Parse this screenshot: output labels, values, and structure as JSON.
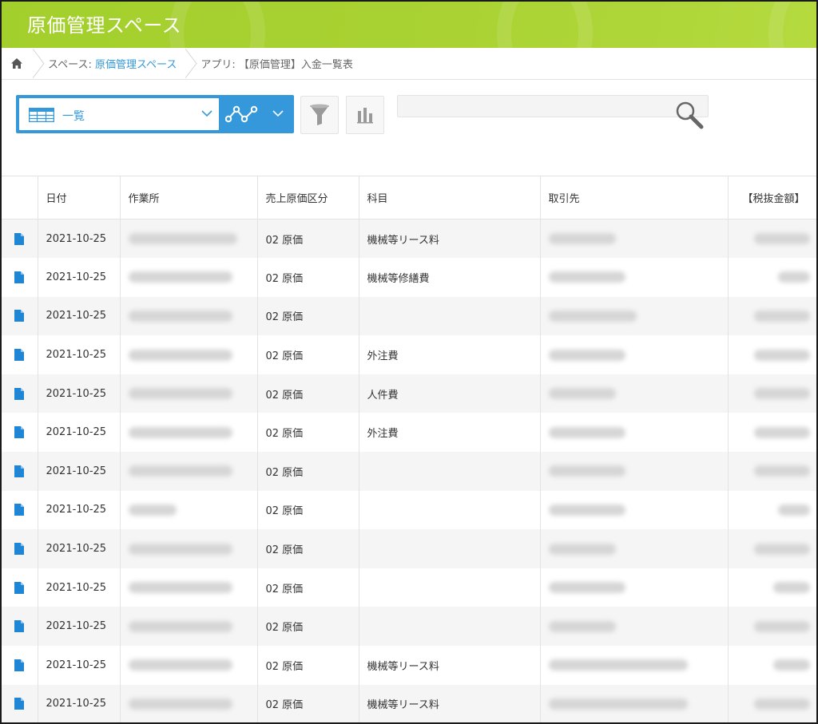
{
  "header": {
    "title": "原価管理スペース",
    "color": "#a9d232"
  },
  "breadcrumb": {
    "space_prefix": "スペース: ",
    "space_name": "原価管理スペース",
    "app_label": "アプリ: 【原価管理】入金一覧表"
  },
  "toolbar": {
    "view_label": "一覧",
    "search_placeholder": "",
    "accent_color": "#3498db"
  },
  "table": {
    "headers": [
      "日付",
      "作業所",
      "売上原価区分",
      "科目",
      "取引先",
      "【税抜金額】"
    ],
    "rows": [
      {
        "date": "2021-10-25",
        "category": "02 原価",
        "account": "機械等リース料"
      },
      {
        "date": "2021-10-25",
        "category": "02 原価",
        "account": "機械等修繕費"
      },
      {
        "date": "2021-10-25",
        "category": "02 原価",
        "account": ""
      },
      {
        "date": "2021-10-25",
        "category": "02 原価",
        "account": "外注費"
      },
      {
        "date": "2021-10-25",
        "category": "02 原価",
        "account": "人件費"
      },
      {
        "date": "2021-10-25",
        "category": "02 原価",
        "account": "外注費"
      },
      {
        "date": "2021-10-25",
        "category": "02 原価",
        "account": ""
      },
      {
        "date": "2021-10-25",
        "category": "02 原価",
        "account": ""
      },
      {
        "date": "2021-10-25",
        "category": "02 原価",
        "account": ""
      },
      {
        "date": "2021-10-25",
        "category": "02 原価",
        "account": ""
      },
      {
        "date": "2021-10-25",
        "category": "02 原価",
        "account": ""
      },
      {
        "date": "2021-10-25",
        "category": "02 原価",
        "account": "機械等リース料"
      },
      {
        "date": "2021-10-25",
        "category": "02 原価",
        "account": "機械等リース料"
      }
    ]
  }
}
